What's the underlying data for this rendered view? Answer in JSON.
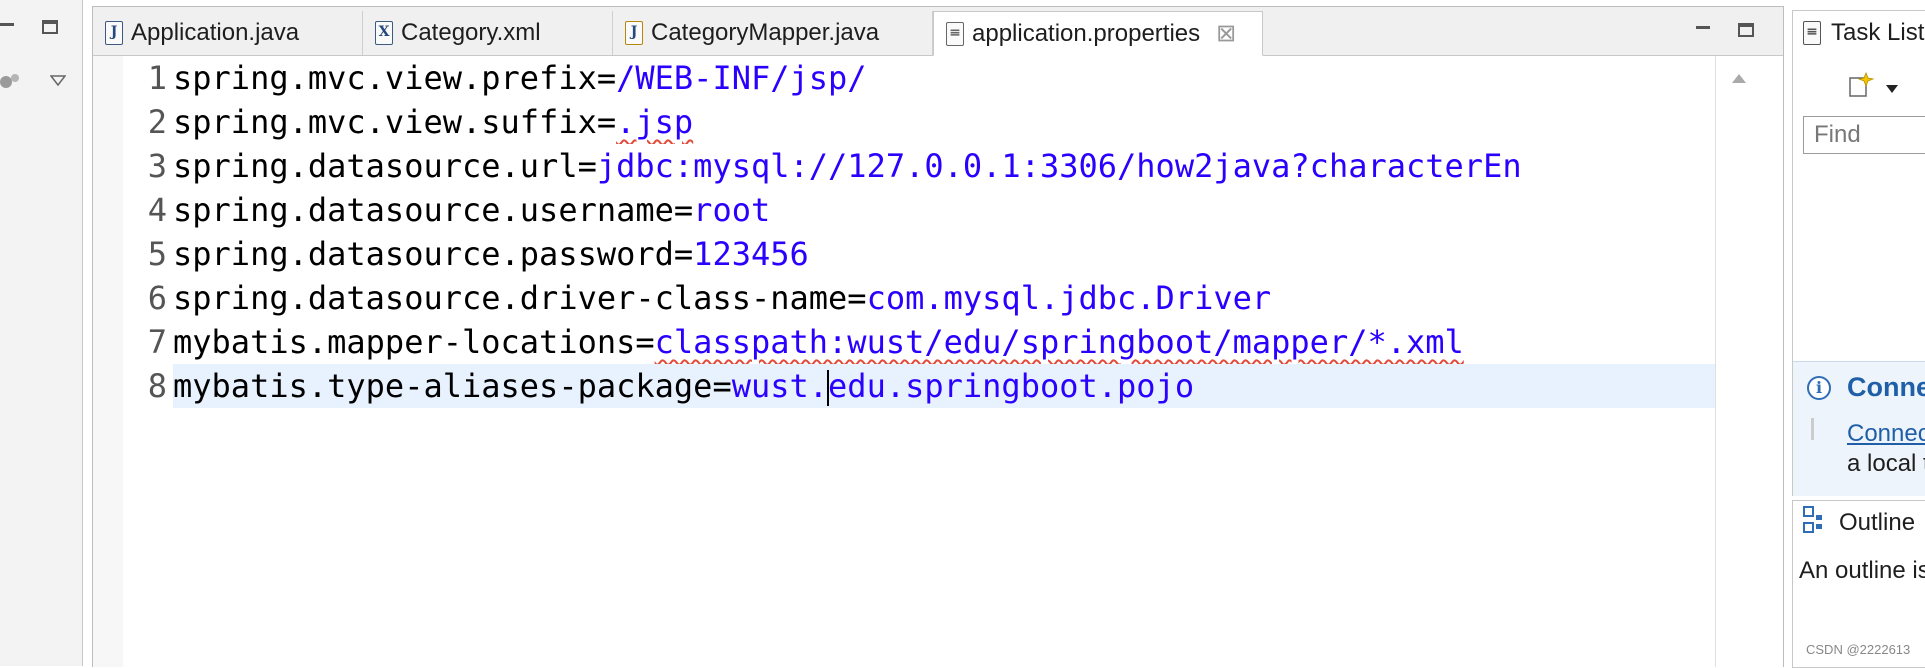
{
  "editor": {
    "tabs": [
      {
        "label": "Application.java",
        "icon": "java-file-icon",
        "active": false
      },
      {
        "label": "Category.xml",
        "icon": "xml-file-icon",
        "active": false
      },
      {
        "label": "CategoryMapper.java",
        "icon": "java-file-warning-icon",
        "active": false
      },
      {
        "label": "application.properties",
        "icon": "properties-file-icon",
        "active": true
      }
    ],
    "close_glyph": "⊠",
    "lines": [
      {
        "n": "1",
        "key": "spring.mvc.view.prefix=",
        "value": "/WEB-INF/jsp/"
      },
      {
        "n": "2",
        "key": "spring.mvc.view.suffix=",
        "value": ".jsp"
      },
      {
        "n": "3",
        "key": "spring.datasource.url=",
        "value": "jdbc:mysql://127.0.0.1:3306/how2java?characterEn"
      },
      {
        "n": "4",
        "key": "spring.datasource.username=",
        "value": "root"
      },
      {
        "n": "5",
        "key": "spring.datasource.password=",
        "value": "123456"
      },
      {
        "n": "6",
        "key": "spring.datasource.driver-class-name=",
        "value": "com.mysql.jdbc.Driver"
      },
      {
        "n": "7",
        "key": "mybatis.mapper-locations=",
        "value": "classpath:wust/edu/springboot/mapper/*.xml"
      },
      {
        "n": "8",
        "key": "mybatis.type-aliases-package=",
        "value_before_caret": "wust.",
        "value_after_caret": "edu.springboot.pojo"
      }
    ]
  },
  "task_list": {
    "title": "Task List",
    "find_placeholder": "Find",
    "connect_title": "Conne",
    "connect_link": "Connec",
    "connect_text": "a local t"
  },
  "outline": {
    "title": "Outline",
    "text": "An outline is"
  },
  "watermark": "CSDN @2222613"
}
